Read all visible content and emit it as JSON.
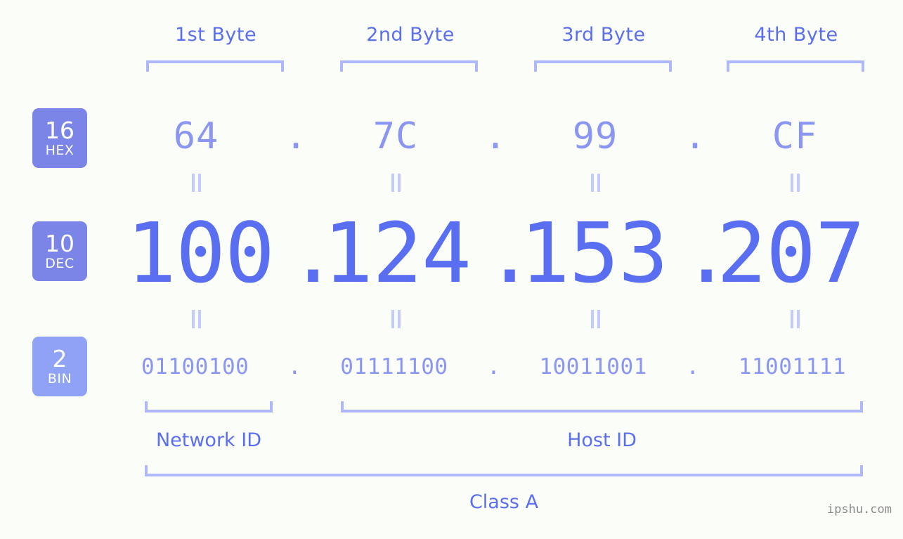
{
  "background_color": "#fbfdf8",
  "accent_color": "#5a6ef2",
  "accent_light_color": "#8b96f3",
  "bracket_color": "#aeb8fb",
  "byte_headers": [
    {
      "label": "1st Byte"
    },
    {
      "label": "2nd Byte"
    },
    {
      "label": "3rd Byte"
    },
    {
      "label": "4th Byte"
    }
  ],
  "rows": [
    {
      "badge_number": "16",
      "badge_base": "HEX",
      "badge_color": "#7b85e8",
      "values": [
        "64",
        "7C",
        "99",
        "CF"
      ],
      "separator": "."
    },
    {
      "badge_number": "10",
      "badge_base": "DEC",
      "badge_color": "#7b85e8",
      "values": [
        "100",
        "124",
        "153",
        "207"
      ],
      "separator": "."
    },
    {
      "badge_number": "2",
      "badge_base": "BIN",
      "badge_color": "#8fa2f5",
      "values": [
        "01100100",
        "01111100",
        "10011001",
        "11001111"
      ],
      "separator": "."
    }
  ],
  "equals_symbol": "=",
  "sections": [
    {
      "label": "Network ID"
    },
    {
      "label": "Host ID"
    }
  ],
  "class_label": "Class A",
  "watermark": "ipshu.com"
}
